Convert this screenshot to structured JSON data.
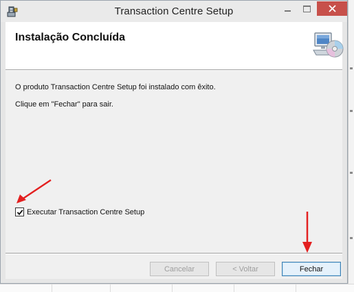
{
  "window": {
    "title": "Transaction Centre Setup"
  },
  "header": {
    "title": "Instalação Concluída",
    "icon": "computer-cd-setup-icon"
  },
  "body": {
    "message_line1": "O produto Transaction Centre Setup foi instalado com êxito.",
    "message_line2": "Clique em \"Fechar\" para sair."
  },
  "launch_option": {
    "label": "Executar Transaction Centre Setup",
    "checked": true
  },
  "buttons": {
    "cancel": "Cancelar",
    "back": "< Voltar",
    "close": "Fechar"
  },
  "colors": {
    "annotation_arrow": "#e32020",
    "close_button_accent": "#c7504a"
  }
}
